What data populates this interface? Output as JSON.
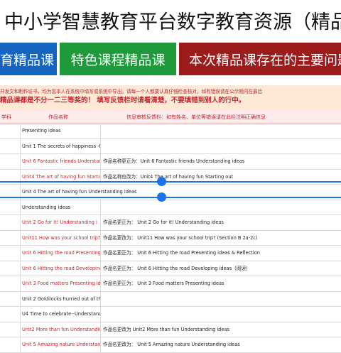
{
  "banner": {
    "title": "中小学智慧教育平台数字教育资源（精品课）获奖名"
  },
  "tabs": [
    {
      "label": "育精品课",
      "color": "#1565c0"
    },
    {
      "label": "特色课程精品课",
      "color": "#1f9a3a"
    },
    {
      "label": "本次精品课存在的主要问题",
      "color": "#9c1c1c"
    }
  ],
  "notice": {
    "line1": "开发文和制作证书，均为您本人在系统中填写或系统中导出，请每一个人都要认真仔细检查核对，如有错误请在公示期内在最后",
    "line2": "精品课都是不分一二三等奖的！ 填写反馈栏时请看清楚，不要填错到别人的行中。"
  },
  "table": {
    "headers": {
      "subject": "学科",
      "course": "作品名称",
      "feedback": "信息审核反馈栏：如有姓名、单位等错误请在此栏注明正确信息"
    },
    "rows": [
      {
        "course": "Presenting ideas",
        "feedback": "",
        "red": false
      },
      {
        "course": "Unit 1 The secrets of happiness -Reflection",
        "feedback": "",
        "red": false
      },
      {
        "course": "Unit 6 Fantastic friends Understan",
        "feedback": "作品名称更正为：Unit 6 Fantastic friends Understanding ideas",
        "red": true
      },
      {
        "course": "Unit4 The art of having fun Startin",
        "feedback": "作品名称应改为：Unit4 The art of having fun Starting out",
        "red": true
      },
      {
        "course": "Unit 4 The art of having fun Understanding ideas",
        "feedback": "",
        "red": false,
        "wide": true
      },
      {
        "course": "Understanding ideas",
        "feedback": "",
        "red": false
      },
      {
        "course": "Unit 2 Go for it!  Understanding i",
        "feedback": "作品名更正为：  Unit 2 Go for it!  Understanding ideas",
        "red": true
      },
      {
        "course": "Unit11 How was your school trip?",
        "feedback": "作品名更改为：  Unit11 How was your school trip? (Section B 2a-2c)",
        "red": true
      },
      {
        "course": "Unit 6 Hitting the road  Presenting",
        "feedback": "作品名更正为：  Unit 6 Hitting the road  Presenting ideas & Reflection",
        "red": true
      },
      {
        "course": "Unit 6 Hitting the road Developing",
        "feedback": "作品名更正为：  Unit 6 Hitting the road Developing ideas（阅读）",
        "red": true
      },
      {
        "course": "Unit 3 Food matters Presenting ide",
        "feedback": "作品名更正为：  Unit 3 Food matters Presenting ideas",
        "red": true
      },
      {
        "course": "Unit 2 Goldilocks hurried out of the house.",
        "feedback": "",
        "red": false
      },
      {
        "course": "U4 Time to celebrate--Understanding ideas",
        "feedback": "",
        "red": false
      },
      {
        "course": "Unit2 More than fun Understandin",
        "feedback": "作品名更改为 Unit2 More than fun Understanding ideas",
        "red": true
      },
      {
        "course": "Unit 5 Amazing nature Understand",
        "feedback": "作品名更改为：  Unit 5 Amazing nature Understanding ideas",
        "red": true
      }
    ]
  },
  "colors": {
    "selection": "#1a73e8",
    "accent_red": "#c0262d"
  }
}
